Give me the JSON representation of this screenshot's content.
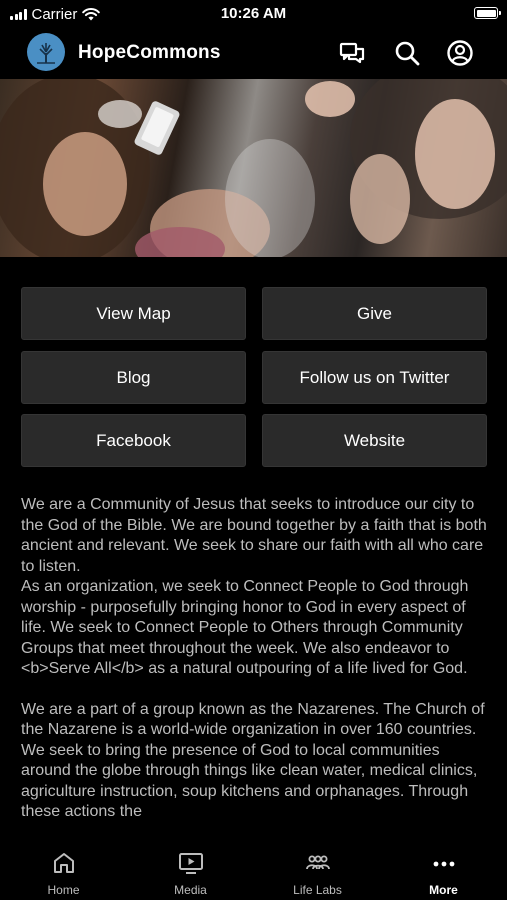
{
  "status": {
    "carrier": "Carrier",
    "time": "10:26 AM"
  },
  "header": {
    "title": "HopeCommons"
  },
  "buttons": {
    "view_map": "View Map",
    "give": "Give",
    "blog": "Blog",
    "twitter": "Follow us on Twitter",
    "facebook": "Facebook",
    "website": "Website"
  },
  "about": {
    "p1": "We are a Community of Jesus that seeks to introduce our city to the God of the Bible. We are bound together by a faith that is both ancient and relevant. We seek to share our faith with all who care to listen.",
    "p2": "As an organization, we seek to Connect People to God through worship  - purposefully bringing honor to God in every aspect of life. We seek to Connect People to Others through Community Groups that meet throughout the week. We also endeavor to <b>Serve All</b> as a natural outpouring of a life lived for God.",
    "p3": "We are a part of a group known as the Nazarenes. The Church of the Nazarene is a world-wide organization in over 160 countries. We seek to bring the presence of God to local communities around the globe through things like clean water, medical clinics, agriculture instruction, soup kitchens and orphanages. Through these actions the"
  },
  "tabs": [
    {
      "label": "Home",
      "icon": "home-icon"
    },
    {
      "label": "Media",
      "icon": "media-icon"
    },
    {
      "label": "Life Labs",
      "icon": "group-icon"
    },
    {
      "label": "More",
      "icon": "more-icon"
    }
  ],
  "colors": {
    "background": "#000000",
    "button": "#2a2a2a",
    "text_muted": "#bdbdbd",
    "logo": "#4a8fc4"
  }
}
